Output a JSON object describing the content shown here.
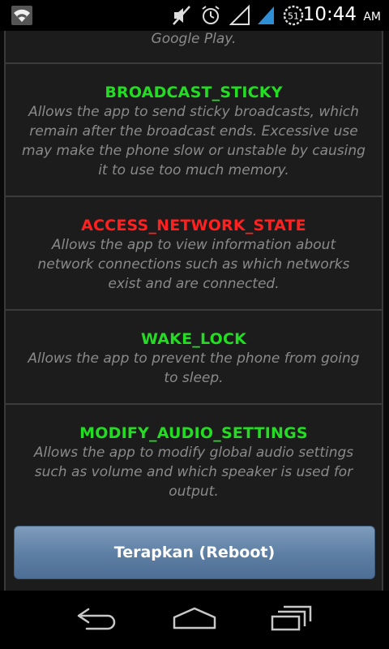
{
  "status_bar": {
    "time": "10:44",
    "ampm": "AM",
    "icons": [
      "wifi-icon",
      "mute-icon",
      "alarm-icon",
      "signal-empty-icon",
      "signal-icon",
      "battery-icon"
    ],
    "battery_level": "51"
  },
  "dialog": {
    "top_fragment": "Google Play.",
    "permissions": [
      {
        "name": "BROADCAST_STICKY",
        "color": "#22dd22",
        "description": "Allows the app to send sticky broadcasts, which remain after the broadcast ends. Excessive use may make the phone slow or unstable by causing it to use too much memory."
      },
      {
        "name": "ACCESS_NETWORK_STATE",
        "color": "#ff2020",
        "description": "Allows the app to view information about network connections such as which networks exist and are connected."
      },
      {
        "name": "WAKE_LOCK",
        "color": "#22dd22",
        "description": "Allows the app to prevent the phone from going to sleep."
      },
      {
        "name": "MODIFY_AUDIO_SETTINGS",
        "color": "#22dd22",
        "description": "Allows the app to modify global audio settings such as volume and which speaker is used for output."
      }
    ],
    "apply_button_label": "Terapkan (Reboot)"
  },
  "nav_bar": {
    "icons": [
      "back-icon",
      "home-icon",
      "recent-apps-icon"
    ]
  }
}
